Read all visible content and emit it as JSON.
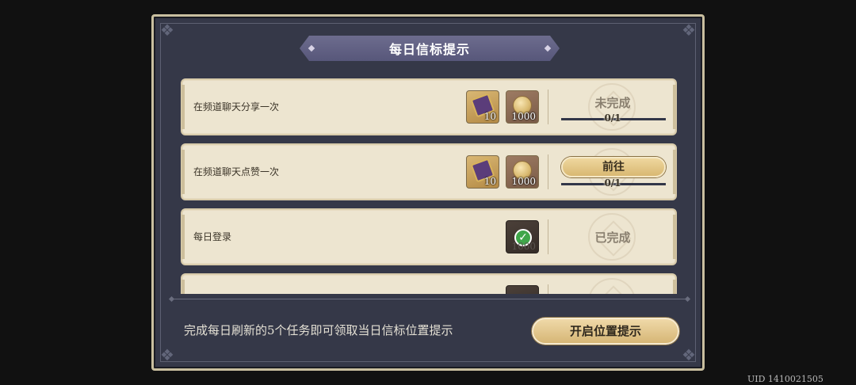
{
  "title": "每日信标提示",
  "tasks": [
    {
      "label": "在频道聊天分享一次",
      "rewards": [
        {
          "icon": "scroll-icon",
          "qty": "10"
        },
        {
          "icon": "coin-icon",
          "qty": "1000"
        }
      ],
      "status": "未完成",
      "progress_text": "0/1",
      "progress": 0
    },
    {
      "label": "在频道聊天点赞一次",
      "rewards": [
        {
          "icon": "scroll-icon",
          "qty": "10"
        },
        {
          "icon": "coin-icon",
          "qty": "1000"
        }
      ],
      "button": "前往",
      "progress_text": "0/1",
      "progress": 0
    },
    {
      "label": "每日登录",
      "rewards": [
        {
          "icon": "check-icon",
          "qty": "1000",
          "claimed": true
        }
      ],
      "status": "已完成"
    },
    {
      "label": "",
      "rewards": [],
      "status": ""
    }
  ],
  "footer": {
    "hint": "完成每日刷新的5个任务即可领取当日信标位置提示",
    "button": "开启位置提示"
  },
  "uid": "UID 1410021505",
  "colors": {
    "panel_bg": "#353848",
    "row_bg": "#ede5d0",
    "button_gold": "#d9b872",
    "check_green": "#3fa64a"
  }
}
